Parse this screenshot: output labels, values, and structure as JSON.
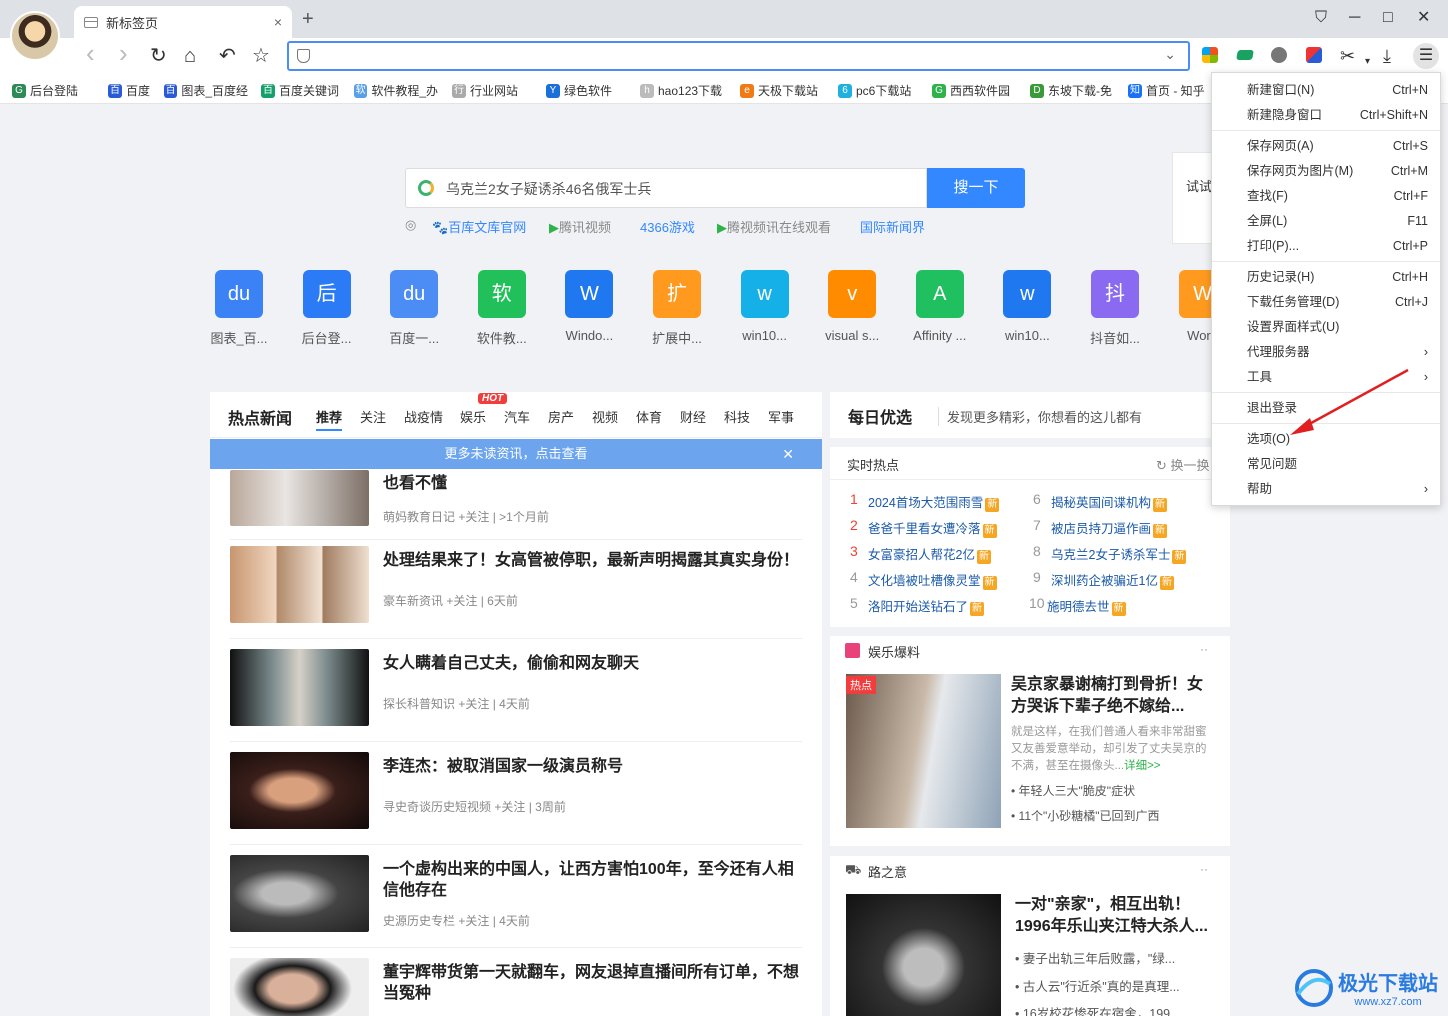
{
  "tab": {
    "title": "新标签页",
    "close": "×",
    "new": "+"
  },
  "window": {
    "minimize": "─",
    "maximize": "□",
    "close": "✕",
    "skin": "⛉"
  },
  "toolbar": {
    "back": "‹",
    "forward": "›",
    "refresh": "↻",
    "home": "⌂",
    "undo": "↶",
    "star": "☆",
    "address_value": ""
  },
  "bookmarks": [
    "后台登陆",
    "百度",
    "图表_百度经",
    "百度关键词",
    "软件教程_办",
    "行业网站",
    "绿色软件",
    "hao123下载",
    "天极下载站",
    "pc6下载站",
    "西西软件园",
    "东坡下载-免",
    "首页 - 知乎"
  ],
  "search": {
    "query": "乌克兰2女子疑诱杀46名俄军士兵",
    "button": "搜一下"
  },
  "hints": [
    "百库文库官网",
    "腾讯视频",
    "4366游戏",
    "腾视频讯在线观看",
    "国际新闻界"
  ],
  "apps": [
    {
      "label": "图表_百...",
      "glyph": "du",
      "color": "#3b82f6"
    },
    {
      "label": "后台登...",
      "glyph": "后",
      "color": "#2b7bf6"
    },
    {
      "label": "百度一...",
      "glyph": "du",
      "color": "#4b8cf5"
    },
    {
      "label": "软件教...",
      "glyph": "软",
      "color": "#22c05a"
    },
    {
      "label": "Windo...",
      "glyph": "W",
      "color": "#1f78f0"
    },
    {
      "label": "扩展中...",
      "glyph": "扩",
      "color": "#ff9a1f"
    },
    {
      "label": "win10...",
      "glyph": "w",
      "color": "#16b0e8"
    },
    {
      "label": "visual s...",
      "glyph": "v",
      "color": "#ff8c00"
    },
    {
      "label": "Affinity ...",
      "glyph": "A",
      "color": "#20c060"
    },
    {
      "label": "win10...",
      "glyph": "w",
      "color": "#1f78f0"
    },
    {
      "label": "抖音如...",
      "glyph": "抖",
      "color": "#8a6af0"
    },
    {
      "label": "Word",
      "glyph": "W",
      "color": "#ff9a1f"
    }
  ],
  "news": {
    "title": "热点新闻",
    "tabs": [
      "推荐",
      "关注",
      "战疫情",
      "娱乐",
      "汽车",
      "房产",
      "视频",
      "体育",
      "财经",
      "科技",
      "军事"
    ],
    "hot_badge": "HOT",
    "unread": "更多未读资讯，点击查看",
    "unread_close": "✕",
    "items": [
      {
        "title": "也看不懂",
        "source": "萌妈教育日记",
        "follow": "+关注",
        "time": ">1个月前"
      },
      {
        "title": "处理结果来了！女高管被停职，最新声明揭露其真实身份！",
        "source": "豪车新资讯",
        "follow": "+关注",
        "time": "6天前"
      },
      {
        "title": "女人瞒着自己丈夫，偷偷和网友聊天",
        "source": "探长科普知识",
        "follow": "+关注",
        "time": "4天前"
      },
      {
        "title": "李连杰：被取消国家一级演员称号",
        "source": "寻史奇谈历史短视频",
        "follow": "+关注",
        "time": "3周前"
      },
      {
        "title": "一个虚构出来的中国人，让西方害怕100年，至今还有人相信他存在",
        "source": "史源历史专栏",
        "follow": "+关注",
        "time": "4天前"
      },
      {
        "title": "董宇辉带货第一天就翻车，网友退掉直播间所有订单，不想当冤种",
        "source": "",
        "follow": "",
        "time": ""
      }
    ]
  },
  "daily": {
    "title": "每日优选",
    "subtitle": "发现更多精彩，你想看的这儿都有"
  },
  "realtime": {
    "title": "实时热点",
    "refresh": "换一换",
    "new_badge": "新",
    "left": [
      {
        "n": "1",
        "t": "2024首场大范围雨雪"
      },
      {
        "n": "2",
        "t": "爸爸千里看女遭冷落"
      },
      {
        "n": "3",
        "t": "女富豪招人帮花2亿"
      },
      {
        "n": "4",
        "t": "文化墙被吐槽像灵堂"
      },
      {
        "n": "5",
        "t": "洛阳开始送钻石了"
      }
    ],
    "right": [
      {
        "n": "6",
        "t": "揭秘英国间谍机构"
      },
      {
        "n": "7",
        "t": "被店员持刀逼作画"
      },
      {
        "n": "8",
        "t": "乌克兰2女子诱杀军士"
      },
      {
        "n": "9",
        "t": "深圳药企被骗近1亿"
      },
      {
        "n": "10",
        "t": "施明德去世"
      }
    ]
  },
  "ent": {
    "title": "娱乐爆料",
    "badge": "热点",
    "headline": "吴京家暴谢楠打到骨折！女方哭诉下辈子绝不嫁给...",
    "desc": "就是这样，在我们普通人看来非常甜蜜又友善爱意举动，却引发了丈夫吴京的不满，甚至在摄像头...",
    "more": "详细>>",
    "bullets": [
      "年轻人三大\"脆皮\"症状",
      "11个\"小砂糖橘\"已回到广西"
    ],
    "menu": "··"
  },
  "road": {
    "title": "路之意",
    "headline": "一对\"亲家\"，相互出轨！1996年乐山夹江特大杀人...",
    "bullets": [
      "妻子出轨三年后败露，\"绿...",
      "古人云\"行近杀\"真的是真理...",
      "16岁校花惨死在宿舍，199..."
    ],
    "menu": "··"
  },
  "try_label": "试试",
  "menu": {
    "groups": [
      [
        {
          "label": "新建窗口(N)",
          "key": "Ctrl+N"
        },
        {
          "label": "新建隐身窗口",
          "key": "Ctrl+Shift+N"
        }
      ],
      [
        {
          "label": "保存网页(A)",
          "key": "Ctrl+S"
        },
        {
          "label": "保存网页为图片(M)",
          "key": "Ctrl+M"
        },
        {
          "label": "查找(F)",
          "key": "Ctrl+F"
        },
        {
          "label": "全屏(L)",
          "key": "F11"
        },
        {
          "label": "打印(P)...",
          "key": "Ctrl+P"
        }
      ],
      [
        {
          "label": "历史记录(H)",
          "key": "Ctrl+H"
        },
        {
          "label": "下载任务管理(D)",
          "key": "Ctrl+J"
        },
        {
          "label": "设置界面样式(U)",
          "key": ""
        },
        {
          "label": "代理服务器",
          "key": "›"
        },
        {
          "label": "工具",
          "key": "›"
        }
      ],
      [
        {
          "label": "退出登录",
          "key": ""
        }
      ],
      [
        {
          "label": "选项(O)",
          "key": ""
        },
        {
          "label": "常见问题",
          "key": ""
        },
        {
          "label": "帮助",
          "key": "›"
        }
      ]
    ]
  },
  "watermark": {
    "brand": "极光下载站",
    "url": "www.xz7.com"
  },
  "colors": {
    "accent": "#3388ff",
    "arrow": "#e02020",
    "hot": "#f23d3d"
  }
}
